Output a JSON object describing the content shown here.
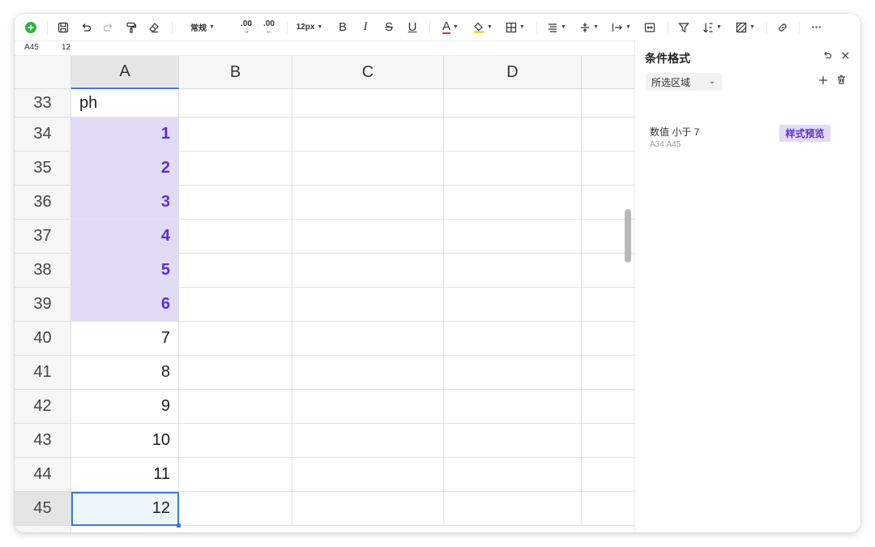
{
  "toolbar": {
    "number_format": "常规",
    "font_size": "12px",
    "decimal_increase": ".00",
    "decimal_decrease": ".00",
    "bold": "B",
    "italic": "I",
    "strike": "S",
    "underline": "U",
    "font_color_letter": "A",
    "more": "···"
  },
  "formula_bar": {
    "cell_ref": "A45",
    "value": "12"
  },
  "grid": {
    "columns": [
      "A",
      "B",
      "C",
      "D"
    ],
    "rows": [
      {
        "num": "33",
        "a": "ph",
        "type": "text"
      },
      {
        "num": "34",
        "a": "1",
        "type": "hl"
      },
      {
        "num": "35",
        "a": "2",
        "type": "hl"
      },
      {
        "num": "36",
        "a": "3",
        "type": "hl"
      },
      {
        "num": "37",
        "a": "4",
        "type": "hl"
      },
      {
        "num": "38",
        "a": "5",
        "type": "hl"
      },
      {
        "num": "39",
        "a": "6",
        "type": "hl"
      },
      {
        "num": "40",
        "a": "7",
        "type": "num"
      },
      {
        "num": "41",
        "a": "8",
        "type": "num"
      },
      {
        "num": "42",
        "a": "9",
        "type": "num"
      },
      {
        "num": "43",
        "a": "10",
        "type": "num"
      },
      {
        "num": "44",
        "a": "11",
        "type": "num"
      },
      {
        "num": "45",
        "a": "12",
        "type": "sel"
      }
    ]
  },
  "panel": {
    "title": "条件格式",
    "scope_label": "所选区域",
    "rule": {
      "description": "数值 小于 7",
      "range": "A34:A45",
      "preview_label": "样式预览"
    }
  },
  "colors": {
    "highlight_bg": "#e2dbf5",
    "highlight_text": "#5b2fd0",
    "selection": "#3a7bd5"
  }
}
